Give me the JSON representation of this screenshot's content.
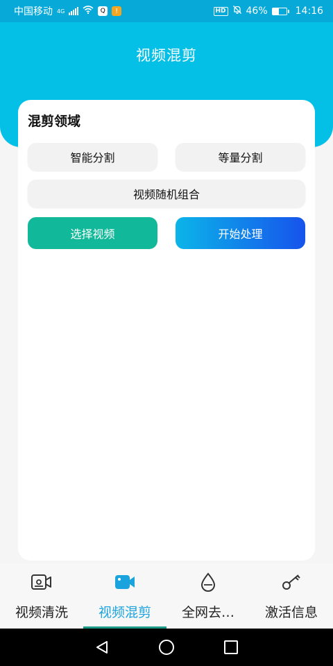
{
  "status_bar": {
    "carrier": "中国移动",
    "network": "4G",
    "qq_icon_text": "Q",
    "notification_icon_text": "!",
    "hd": "HD",
    "battery": "46%",
    "battery_level": 0.46,
    "time": "14:16"
  },
  "header": {
    "title": "视频混剪",
    "color": "#04c0e6"
  },
  "card": {
    "title": "混剪领域",
    "buttons": {
      "smart_split": "智能分割",
      "equal_split": "等量分割",
      "random_combine": "视频随机组合",
      "select_video": "选择视频",
      "start_process": "开始处理"
    },
    "colors": {
      "select_video": "#11b899",
      "start_gradient_from": "#0bb5e9",
      "start_gradient_to": "#1753ec"
    }
  },
  "bottom_nav": {
    "active_index": 1,
    "items": [
      {
        "label": "视频清洗",
        "icon": "video-camera-outline-icon"
      },
      {
        "label": "视频混剪",
        "icon": "video-camera-filled-icon"
      },
      {
        "label": "全网去…",
        "icon": "water-drop-icon"
      },
      {
        "label": "激活信息",
        "icon": "key-icon"
      }
    ],
    "active_color": "#1aa3dc",
    "indicator_color": "#1c9a88"
  },
  "system_nav": {
    "icons": [
      "back-triangle-icon",
      "home-circle-icon",
      "recents-square-icon"
    ]
  }
}
